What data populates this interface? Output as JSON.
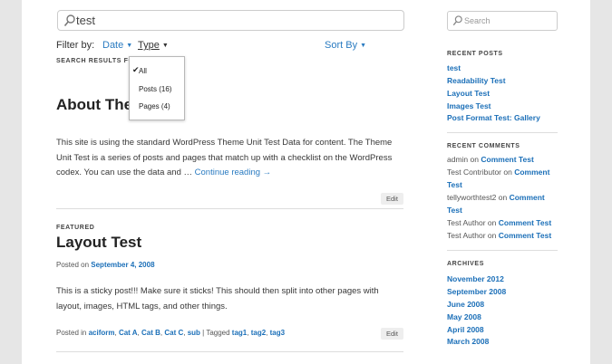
{
  "search": {
    "value": "test"
  },
  "filter": {
    "label": "Filter by:",
    "date": "Date",
    "type": "Type",
    "sort": "Sort By"
  },
  "results_heading": "SEARCH RESULTS FO",
  "type_dropdown": {
    "items": [
      "All",
      "Posts (16)",
      "Pages (4)"
    ],
    "selected": "All"
  },
  "post1": {
    "title": "About The",
    "body": "This site is using the standard WordPress Theme Unit Test Data for content. The Theme Unit Test is a series of posts and pages that match up with a checklist on the WordPress codex. You can use the data and …",
    "continue": "Continue reading →",
    "edit": "Edit"
  },
  "post2": {
    "label": "FEATURED",
    "title": "Layout Test",
    "posted_prefix": "Posted on",
    "date": "September 4, 2008",
    "body": "This is a sticky post!!! Make sure it sticks! This should then split into other pages with layout, images, HTML tags, and other things.",
    "posted_in": "Posted in",
    "categories": [
      "aciform",
      "Cat A",
      "Cat B",
      "Cat C",
      "sub"
    ],
    "tagged": "| Tagged",
    "tags": [
      "tag1",
      "tag2",
      "tag3"
    ],
    "edit": "Edit"
  },
  "sidebar": {
    "search_placeholder": "Search",
    "recent_posts": {
      "title": "RECENT POSTS",
      "items": [
        "test",
        "Readability Test",
        "Layout Test",
        "Images Test",
        "Post Format Test: Gallery"
      ]
    },
    "recent_comments": {
      "title": "RECENT COMMENTS",
      "items": [
        {
          "author": "admin",
          "on": "on",
          "post": "Comment Test"
        },
        {
          "author": "Test Contributor",
          "on": "on",
          "post": "Comment Test"
        },
        {
          "author": "tellyworthtest2",
          "on": "on",
          "post": "Comment Test"
        },
        {
          "author": "Test Author",
          "on": "on",
          "post": "Comment Test"
        },
        {
          "author": "Test Author",
          "on": "on",
          "post": "Comment Test"
        }
      ]
    },
    "archives": {
      "title": "ARCHIVES",
      "items": [
        "November 2012",
        "September 2008",
        "June 2008",
        "May 2008",
        "April 2008",
        "March 2008"
      ]
    }
  }
}
